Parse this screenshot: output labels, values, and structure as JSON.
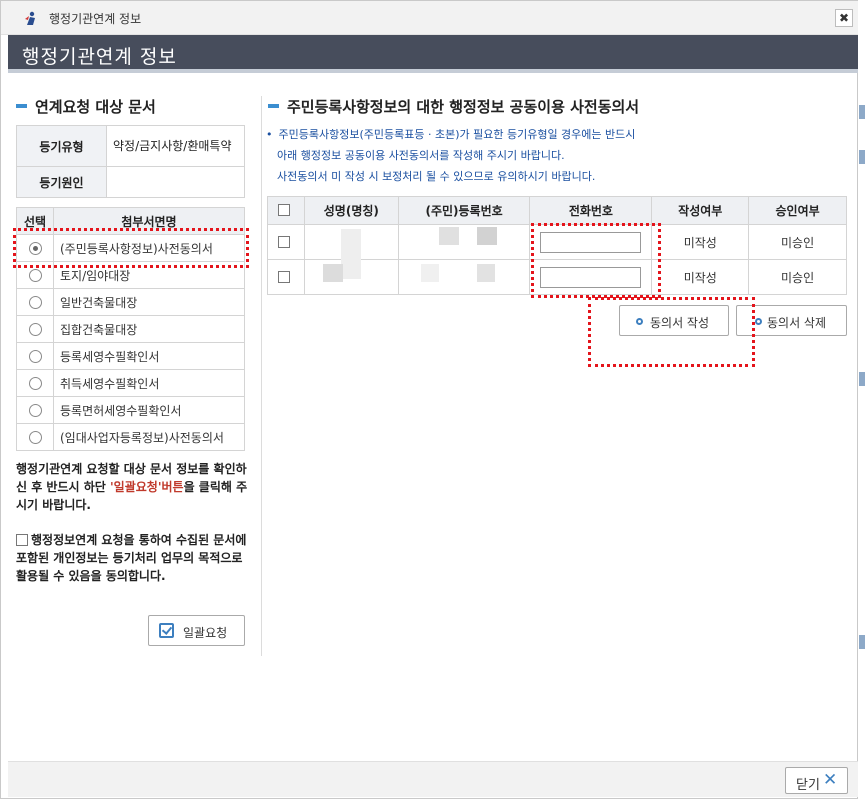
{
  "window": {
    "title": "행정기관연계 정보",
    "close_label": "✖"
  },
  "header": {
    "title": "행정기관연계 정보"
  },
  "left": {
    "section_title": "연계요청 대상 문서",
    "info_rows": [
      {
        "label": "등기유형",
        "value": "약정/금지사항/환매특약"
      },
      {
        "label": "등기원인",
        "value": ""
      }
    ],
    "doc_table": {
      "headers": [
        "선택",
        "첨부서면명"
      ],
      "rows": [
        {
          "name": "(주민등록사항정보)사전동의서",
          "selected": true
        },
        {
          "name": "토지/임야대장",
          "selected": false
        },
        {
          "name": "일반건축물대장",
          "selected": false
        },
        {
          "name": "집합건축물대장",
          "selected": false
        },
        {
          "name": "등록세영수필확인서",
          "selected": false
        },
        {
          "name": "취득세영수필확인서",
          "selected": false
        },
        {
          "name": "등록면허세영수필확인서",
          "selected": false
        },
        {
          "name": "(임대사업자등록정보)사전동의서",
          "selected": false
        }
      ]
    },
    "note_pre": "행정기관연계 요청할 대상 문서 정보를 확인하신 후 반드시 하단 ",
    "note_red": "'일괄요청'버튼",
    "note_post": "을 클릭해 주시기 바랍니다.",
    "consent_text": "행정정보연계 요청을 통하여 수집된 문서에 포함된 개인정보는 등기처리 업무의 목적으로 활용될 수 있음을 동의합니다.",
    "bulk_button_label": "일괄요청"
  },
  "right": {
    "section_title": "주민등록사항정보의 대한 행정정보 공동이용 사전동의서",
    "info_lines": [
      "주민등록사항정보(주민등록표등 · 초본)가 필요한 등기유형일 경우에는 반드시",
      "아래 행정정보 공동이용 사전동의서를 작성해 주시기 바랍니다.",
      "사전동의서 미 작성 시 보정처리 될 수 있으므로 유의하시기 바랍니다."
    ],
    "table": {
      "headers": [
        "성명(명칭)",
        "(주민)등록번호",
        "전화번호",
        "작성여부",
        "승인여부"
      ],
      "rows": [
        {
          "name": "",
          "reg_no": "",
          "phone": "",
          "written": "미작성",
          "approved": "미승인"
        },
        {
          "name": "",
          "reg_no": "",
          "phone": "",
          "written": "미작성",
          "approved": "미승인"
        }
      ]
    },
    "write_button_label": "동의서 작성",
    "delete_button_label": "동의서 삭제"
  },
  "footer": {
    "close_label": "닫기"
  },
  "colors": {
    "header_bg": "#474d5c",
    "accent_blue": "#3b8ed0",
    "highlight_red": "#e4141b",
    "info_text": "#1a4fa0"
  }
}
